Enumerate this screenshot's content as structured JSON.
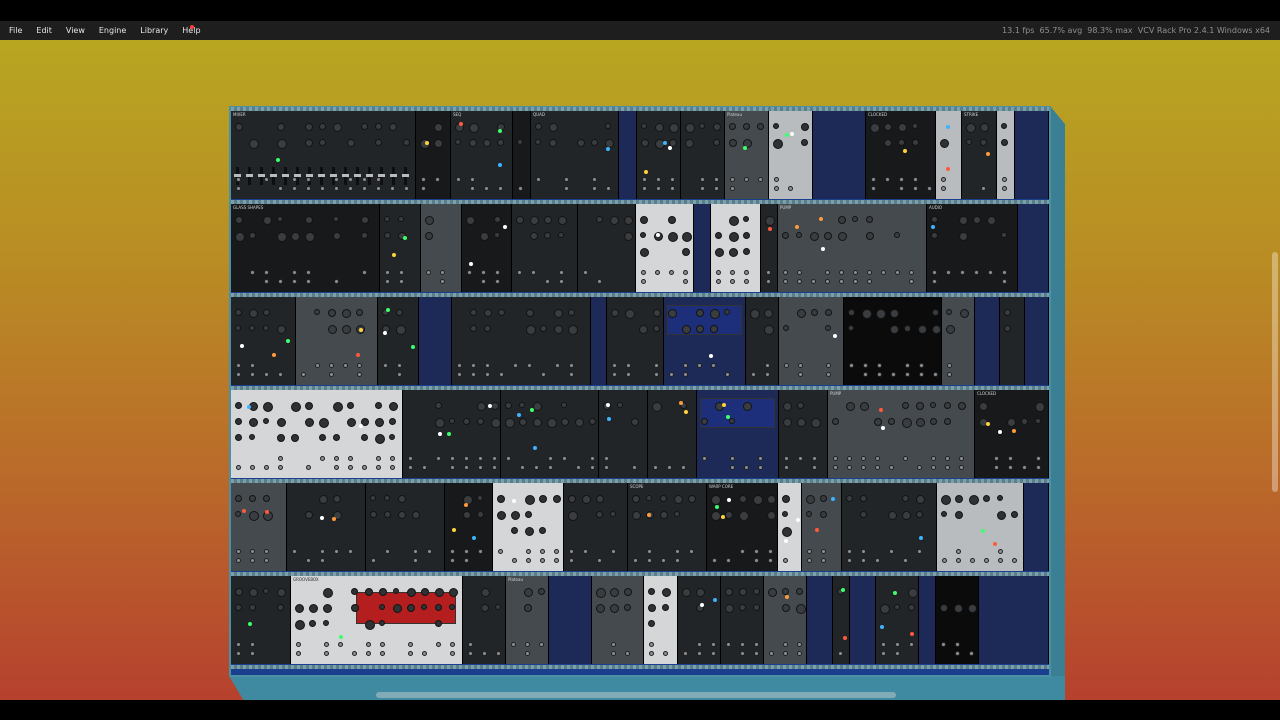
{
  "menu": [
    {
      "label": "File",
      "name": "menu-file"
    },
    {
      "label": "Edit",
      "name": "menu-edit"
    },
    {
      "label": "View",
      "name": "menu-view"
    },
    {
      "label": "Engine",
      "name": "menu-engine"
    },
    {
      "label": "Library",
      "name": "menu-library"
    },
    {
      "label": "Help",
      "name": "menu-help",
      "notify": true
    }
  ],
  "status": {
    "fps": "13.1 fps",
    "avg": "65.7% avg",
    "max": "98.3% max",
    "version": "VCV Rack Pro 2.4.1 Windows x64"
  },
  "colors": {
    "menubar_bg": "#1e1e1e",
    "workspace_top": "#b8a621",
    "workspace_bottom": "#b6412e",
    "rack_frame": "#1a3f8e",
    "rack_border": "#4a90a6"
  },
  "rack_rows": [
    [
      {
        "t": "MIXER",
        "c": "dark",
        "u": 21
      },
      {
        "t": "",
        "c": "darker",
        "u": 4
      },
      {
        "t": "SEQ",
        "c": "dark",
        "u": 7
      },
      {
        "t": "",
        "c": "darker",
        "u": 2
      },
      {
        "t": "QUAD",
        "c": "dark",
        "u": 10
      },
      {
        "t": "",
        "c": "navy",
        "u": 2
      },
      {
        "t": "",
        "c": "dark",
        "u": 5
      },
      {
        "t": "",
        "c": "dark",
        "u": 5
      },
      {
        "t": "Plateau",
        "c": "gray",
        "u": 5
      },
      {
        "t": "",
        "c": "silver",
        "u": 5
      },
      {
        "t": "",
        "c": "navy",
        "u": 6
      },
      {
        "t": "CLOCKED",
        "c": "darker",
        "u": 8
      },
      {
        "t": "",
        "c": "silver",
        "u": 3
      },
      {
        "t": "STRIKE",
        "c": "dark",
        "u": 4
      },
      {
        "t": "",
        "c": "silver",
        "u": 2
      },
      {
        "t": "",
        "c": "navy",
        "u": 4
      }
    ],
    [
      {
        "t": "GLASS SHAPES",
        "c": "darker",
        "u": 18
      },
      {
        "t": "",
        "c": "dark",
        "u": 5
      },
      {
        "t": "",
        "c": "gray",
        "u": 5
      },
      {
        "t": "",
        "c": "darker",
        "u": 6
      },
      {
        "t": "",
        "c": "dark",
        "u": 8
      },
      {
        "t": "",
        "c": "dark",
        "u": 7
      },
      {
        "t": "",
        "c": "light",
        "u": 7
      },
      {
        "t": "",
        "c": "navy",
        "u": 2
      },
      {
        "t": "",
        "c": "light",
        "u": 6
      },
      {
        "t": "",
        "c": "dark",
        "u": 2
      },
      {
        "t": "PUMP",
        "c": "gray",
        "u": 18
      },
      {
        "t": "AUDIO",
        "c": "darker",
        "u": 11
      },
      {
        "t": "",
        "c": "navy",
        "u": 4
      }
    ],
    [
      {
        "t": "",
        "c": "dark",
        "u": 8
      },
      {
        "t": "",
        "c": "gray",
        "u": 10
      },
      {
        "t": "",
        "c": "dark",
        "u": 5
      },
      {
        "t": "",
        "c": "navy",
        "u": 4
      },
      {
        "t": "",
        "c": "dark",
        "u": 17
      },
      {
        "t": "",
        "c": "navy",
        "u": 2
      },
      {
        "t": "",
        "c": "dark",
        "u": 7
      },
      {
        "t": "",
        "c": "blue",
        "u": 10
      },
      {
        "t": "",
        "c": "dark",
        "u": 4
      },
      {
        "t": "",
        "c": "gray",
        "u": 8
      },
      {
        "t": "",
        "c": "jetblack",
        "u": 12
      },
      {
        "t": "",
        "c": "gray",
        "u": 4
      },
      {
        "t": "",
        "c": "navy",
        "u": 3
      },
      {
        "t": "",
        "c": "dark",
        "u": 3
      },
      {
        "t": "",
        "c": "navy",
        "u": 3
      }
    ],
    [
      {
        "t": "",
        "c": "light",
        "u": 21
      },
      {
        "t": "",
        "c": "dark",
        "u": 12
      },
      {
        "t": "",
        "c": "dark",
        "u": 12
      },
      {
        "t": "",
        "c": "dark",
        "u": 6
      },
      {
        "t": "",
        "c": "dark",
        "u": 6
      },
      {
        "t": "",
        "c": "blue",
        "u": 10
      },
      {
        "t": "",
        "c": "dark",
        "u": 6
      },
      {
        "t": "PUMP",
        "c": "gray",
        "u": 18
      },
      {
        "t": "CLOCKED",
        "c": "darker",
        "u": 9
      }
    ],
    [
      {
        "t": "",
        "c": "gray",
        "u": 7
      },
      {
        "t": "",
        "c": "dark",
        "u": 10
      },
      {
        "t": "",
        "c": "dark",
        "u": 10
      },
      {
        "t": "",
        "c": "darker",
        "u": 6
      },
      {
        "t": "",
        "c": "light",
        "u": 9
      },
      {
        "t": "",
        "c": "dark",
        "u": 8
      },
      {
        "t": "SCOPE",
        "c": "dark",
        "u": 10
      },
      {
        "t": "WARP CORE",
        "c": "darker",
        "u": 9
      },
      {
        "t": "",
        "c": "light",
        "u": 3
      },
      {
        "t": "",
        "c": "gray",
        "u": 5
      },
      {
        "t": "",
        "c": "dark",
        "u": 12
      },
      {
        "t": "",
        "c": "silver",
        "u": 11
      },
      {
        "t": "",
        "c": "navy",
        "u": 3
      }
    ],
    [
      {
        "t": "",
        "c": "dark",
        "u": 7
      },
      {
        "t": "GROOVEBOX",
        "c": "light",
        "u": 20
      },
      {
        "t": "",
        "c": "dark",
        "u": 5
      },
      {
        "t": "Plateau",
        "c": "gray",
        "u": 5
      },
      {
        "t": "",
        "c": "navy",
        "u": 5
      },
      {
        "t": "",
        "c": "gray",
        "u": 6
      },
      {
        "t": "",
        "c": "light",
        "u": 4
      },
      {
        "t": "",
        "c": "dark",
        "u": 5
      },
      {
        "t": "",
        "c": "dark",
        "u": 5
      },
      {
        "t": "",
        "c": "gray",
        "u": 5
      },
      {
        "t": "",
        "c": "navy",
        "u": 3
      },
      {
        "t": "",
        "c": "dark",
        "u": 2
      },
      {
        "t": "",
        "c": "navy",
        "u": 3
      },
      {
        "t": "",
        "c": "dark",
        "u": 5
      },
      {
        "t": "",
        "c": "navy",
        "u": 2
      },
      {
        "t": "",
        "c": "jetblack",
        "u": 5
      },
      {
        "t": "",
        "c": "navy",
        "u": 8
      }
    ]
  ]
}
